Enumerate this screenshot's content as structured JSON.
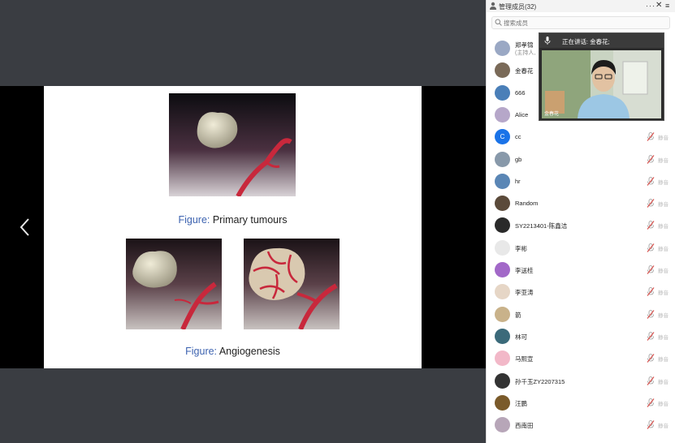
{
  "slide": {
    "caption1": {
      "label": "Figure:",
      "text": " Primary tumours"
    },
    "caption2": {
      "label": "Figure:",
      "text": " Angiogenesis"
    }
  },
  "panel": {
    "title": "管理成员(32)",
    "more": "···",
    "close": "✕",
    "menu": "≡",
    "search_placeholder": "搜索成员"
  },
  "speaker": {
    "status": "正在讲话: 金春花;",
    "tag": "金春花"
  },
  "members": [
    {
      "name": "郑孝锦",
      "sub": "(主持人,",
      "avatar_color": "#9aa8c4",
      "muted": false
    },
    {
      "name": "金春花",
      "avatar_color": "#7a6a58",
      "muted": false
    },
    {
      "name": "666",
      "avatar_color": "#4a7fb8",
      "muted": false
    },
    {
      "name": "Alice",
      "avatar_color": "#b6a7c9",
      "muted": false
    },
    {
      "name": "cc",
      "avatar_color": "#1a73e8",
      "avatar_text": "C",
      "muted": true
    },
    {
      "name": "gb",
      "avatar_color": "#8899aa",
      "muted": true
    },
    {
      "name": "hr",
      "avatar_color": "#5a86b5",
      "muted": true
    },
    {
      "name": "Random",
      "avatar_color": "#5b4a3a",
      "muted": true
    },
    {
      "name": "SY2213401-陈鑫洁",
      "avatar_color": "#2a2a2a",
      "muted": true
    },
    {
      "name": "李彬",
      "avatar_color": "#e8e8e8",
      "muted": true
    },
    {
      "name": "李送桂",
      "avatar_color": "#a268c8",
      "muted": true
    },
    {
      "name": "李亚涛",
      "avatar_color": "#e6d6c6",
      "muted": true
    },
    {
      "name": "箭",
      "avatar_color": "#c9b28a",
      "muted": true
    },
    {
      "name": "林可",
      "avatar_color": "#3b6a7a",
      "muted": true
    },
    {
      "name": "马熙宣",
      "avatar_color": "#f2b8c8",
      "muted": true
    },
    {
      "name": "孙千玉ZY2207315",
      "avatar_color": "#333333",
      "muted": true
    },
    {
      "name": "汪鹏",
      "avatar_color": "#7a5a2a",
      "muted": true
    },
    {
      "name": "西南田",
      "avatar_color": "#b7a6b8",
      "muted": true
    }
  ],
  "mic_label": "静音",
  "colors": {
    "mic_muted": "#d9534f",
    "figure_label": "#3d63b0",
    "vessel": "#c8283c"
  }
}
